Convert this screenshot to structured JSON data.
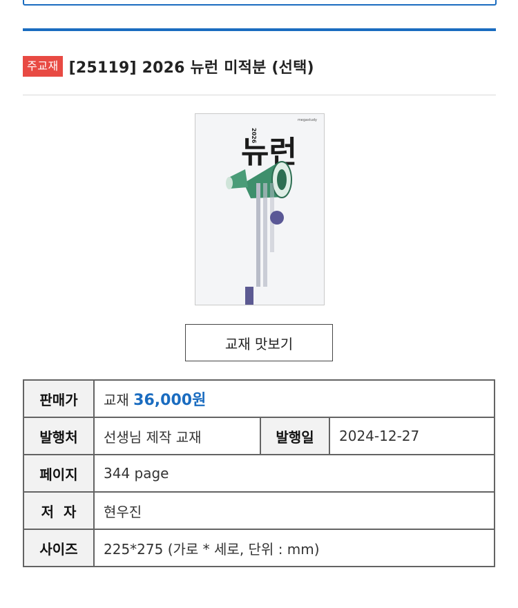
{
  "header": {
    "badge": "주교재",
    "title": "[25119] 2026 뉴런 미적분 (선택)"
  },
  "cover": {
    "publisher": "megastudy",
    "year": "2026",
    "brand": "뉴런"
  },
  "preview_button": "교재 맛보기",
  "info": {
    "price_label": "판매가",
    "price_prefix": "교재",
    "price_value": "36,000원",
    "publisher_label": "발행처",
    "publisher_value": "선생님 제작 교재",
    "date_label": "발행일",
    "date_value": "2024-12-27",
    "pages_label": "페이지",
    "pages_value": "344 page",
    "author_label": "저  자",
    "author_value": "현우진",
    "size_label": "사이즈",
    "size_value": "225*275 (가로 * 세로, 단위 : mm)"
  },
  "colors": {
    "accent_blue": "#1a6cc0",
    "badge_red": "#e84a43"
  }
}
